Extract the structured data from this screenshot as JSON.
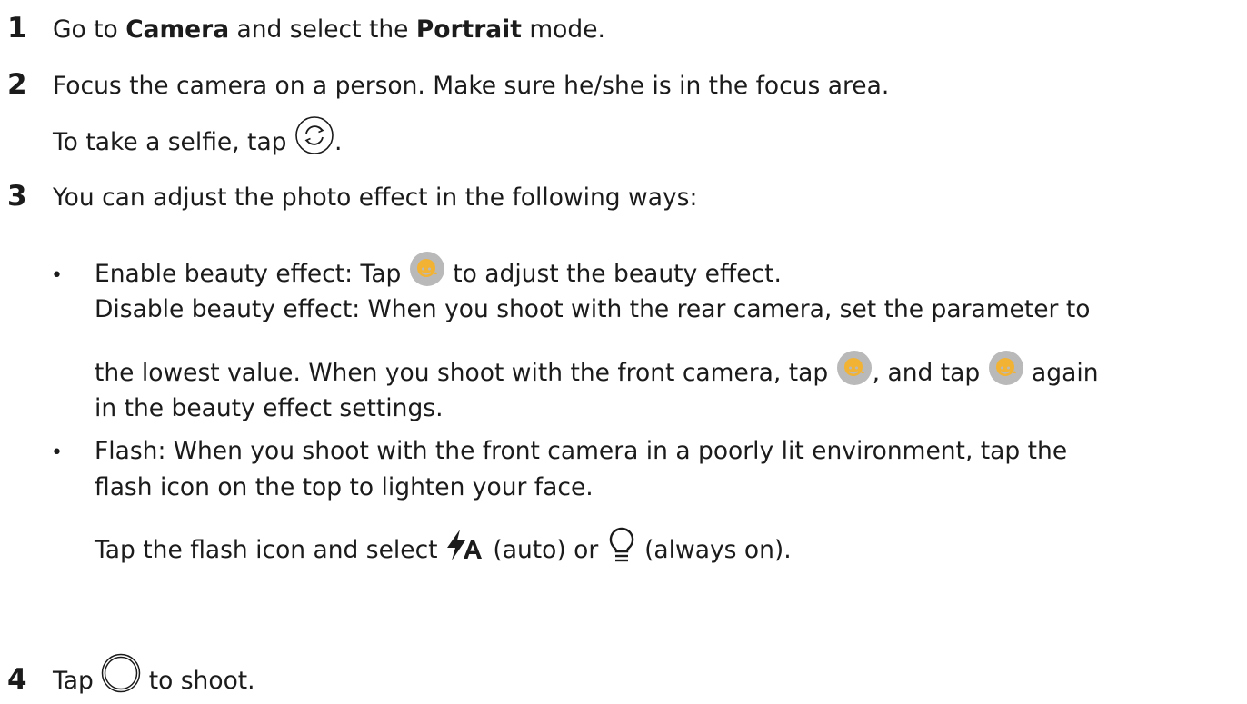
{
  "steps": [
    {
      "num": "1",
      "a": "Go to ",
      "b1": "Camera",
      "c": " and select the ",
      "b2": "Portrait",
      "d": " mode."
    },
    {
      "num": "2",
      "text": "Focus the camera on a person. Make sure he/she is in the focus area.",
      "selfie_pre": "To take a selfie, tap ",
      "selfie_post": "."
    },
    {
      "num": "3",
      "text": "You can adjust the photo effect in the following ways:"
    },
    {
      "num": "4",
      "pre": "Tap ",
      "post": " to shoot."
    }
  ],
  "bullets": {
    "symbol": "•",
    "beauty": {
      "l1_pre": "Enable beauty effect: Tap ",
      "l1_post": " to adjust the beauty effect.",
      "l2": "Disable beauty effect: When you shoot with the rear camera, set the parameter to",
      "l3_pre": "the lowest value. When you shoot with the front camera, tap ",
      "l3_mid": ", and tap ",
      "l3_post": " again",
      "l4": "in the beauty effect settings."
    },
    "flash": {
      "l1": "Flash: When you shoot with the front camera in a poorly lit environment, tap the",
      "l2": "flash icon on the top to lighten your face.",
      "l3_pre": "Tap the flash icon and select ",
      "l3_mid": " (auto) or ",
      "l3_post": " (always on)."
    }
  },
  "icons": {
    "switch": "switch-camera-icon",
    "beauty": "beauty-effect-icon",
    "flash_auto": "flash-auto-icon",
    "flash_on": "flash-always-on-icon",
    "shutter": "shutter-icon"
  },
  "colors": {
    "text": "#1b1b1b",
    "beauty_bg": "#b9b9b9",
    "beauty_fg": "#f2b233"
  }
}
